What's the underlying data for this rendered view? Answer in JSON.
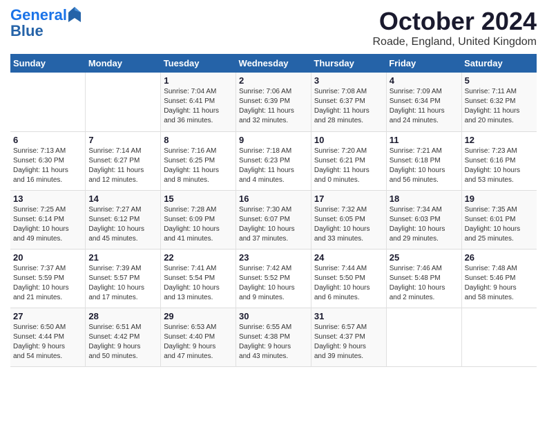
{
  "logo": {
    "line1": "General",
    "line2": "Blue"
  },
  "title": "October 2024",
  "location": "Roade, England, United Kingdom",
  "days_of_week": [
    "Sunday",
    "Monday",
    "Tuesday",
    "Wednesday",
    "Thursday",
    "Friday",
    "Saturday"
  ],
  "weeks": [
    [
      {
        "day": "",
        "info": ""
      },
      {
        "day": "",
        "info": ""
      },
      {
        "day": "1",
        "info": "Sunrise: 7:04 AM\nSunset: 6:41 PM\nDaylight: 11 hours\nand 36 minutes."
      },
      {
        "day": "2",
        "info": "Sunrise: 7:06 AM\nSunset: 6:39 PM\nDaylight: 11 hours\nand 32 minutes."
      },
      {
        "day": "3",
        "info": "Sunrise: 7:08 AM\nSunset: 6:37 PM\nDaylight: 11 hours\nand 28 minutes."
      },
      {
        "day": "4",
        "info": "Sunrise: 7:09 AM\nSunset: 6:34 PM\nDaylight: 11 hours\nand 24 minutes."
      },
      {
        "day": "5",
        "info": "Sunrise: 7:11 AM\nSunset: 6:32 PM\nDaylight: 11 hours\nand 20 minutes."
      }
    ],
    [
      {
        "day": "6",
        "info": "Sunrise: 7:13 AM\nSunset: 6:30 PM\nDaylight: 11 hours\nand 16 minutes."
      },
      {
        "day": "7",
        "info": "Sunrise: 7:14 AM\nSunset: 6:27 PM\nDaylight: 11 hours\nand 12 minutes."
      },
      {
        "day": "8",
        "info": "Sunrise: 7:16 AM\nSunset: 6:25 PM\nDaylight: 11 hours\nand 8 minutes."
      },
      {
        "day": "9",
        "info": "Sunrise: 7:18 AM\nSunset: 6:23 PM\nDaylight: 11 hours\nand 4 minutes."
      },
      {
        "day": "10",
        "info": "Sunrise: 7:20 AM\nSunset: 6:21 PM\nDaylight: 11 hours\nand 0 minutes."
      },
      {
        "day": "11",
        "info": "Sunrise: 7:21 AM\nSunset: 6:18 PM\nDaylight: 10 hours\nand 56 minutes."
      },
      {
        "day": "12",
        "info": "Sunrise: 7:23 AM\nSunset: 6:16 PM\nDaylight: 10 hours\nand 53 minutes."
      }
    ],
    [
      {
        "day": "13",
        "info": "Sunrise: 7:25 AM\nSunset: 6:14 PM\nDaylight: 10 hours\nand 49 minutes."
      },
      {
        "day": "14",
        "info": "Sunrise: 7:27 AM\nSunset: 6:12 PM\nDaylight: 10 hours\nand 45 minutes."
      },
      {
        "day": "15",
        "info": "Sunrise: 7:28 AM\nSunset: 6:09 PM\nDaylight: 10 hours\nand 41 minutes."
      },
      {
        "day": "16",
        "info": "Sunrise: 7:30 AM\nSunset: 6:07 PM\nDaylight: 10 hours\nand 37 minutes."
      },
      {
        "day": "17",
        "info": "Sunrise: 7:32 AM\nSunset: 6:05 PM\nDaylight: 10 hours\nand 33 minutes."
      },
      {
        "day": "18",
        "info": "Sunrise: 7:34 AM\nSunset: 6:03 PM\nDaylight: 10 hours\nand 29 minutes."
      },
      {
        "day": "19",
        "info": "Sunrise: 7:35 AM\nSunset: 6:01 PM\nDaylight: 10 hours\nand 25 minutes."
      }
    ],
    [
      {
        "day": "20",
        "info": "Sunrise: 7:37 AM\nSunset: 5:59 PM\nDaylight: 10 hours\nand 21 minutes."
      },
      {
        "day": "21",
        "info": "Sunrise: 7:39 AM\nSunset: 5:57 PM\nDaylight: 10 hours\nand 17 minutes."
      },
      {
        "day": "22",
        "info": "Sunrise: 7:41 AM\nSunset: 5:54 PM\nDaylight: 10 hours\nand 13 minutes."
      },
      {
        "day": "23",
        "info": "Sunrise: 7:42 AM\nSunset: 5:52 PM\nDaylight: 10 hours\nand 9 minutes."
      },
      {
        "day": "24",
        "info": "Sunrise: 7:44 AM\nSunset: 5:50 PM\nDaylight: 10 hours\nand 6 minutes."
      },
      {
        "day": "25",
        "info": "Sunrise: 7:46 AM\nSunset: 5:48 PM\nDaylight: 10 hours\nand 2 minutes."
      },
      {
        "day": "26",
        "info": "Sunrise: 7:48 AM\nSunset: 5:46 PM\nDaylight: 9 hours\nand 58 minutes."
      }
    ],
    [
      {
        "day": "27",
        "info": "Sunrise: 6:50 AM\nSunset: 4:44 PM\nDaylight: 9 hours\nand 54 minutes."
      },
      {
        "day": "28",
        "info": "Sunrise: 6:51 AM\nSunset: 4:42 PM\nDaylight: 9 hours\nand 50 minutes."
      },
      {
        "day": "29",
        "info": "Sunrise: 6:53 AM\nSunset: 4:40 PM\nDaylight: 9 hours\nand 47 minutes."
      },
      {
        "day": "30",
        "info": "Sunrise: 6:55 AM\nSunset: 4:38 PM\nDaylight: 9 hours\nand 43 minutes."
      },
      {
        "day": "31",
        "info": "Sunrise: 6:57 AM\nSunset: 4:37 PM\nDaylight: 9 hours\nand 39 minutes."
      },
      {
        "day": "",
        "info": ""
      },
      {
        "day": "",
        "info": ""
      }
    ]
  ]
}
